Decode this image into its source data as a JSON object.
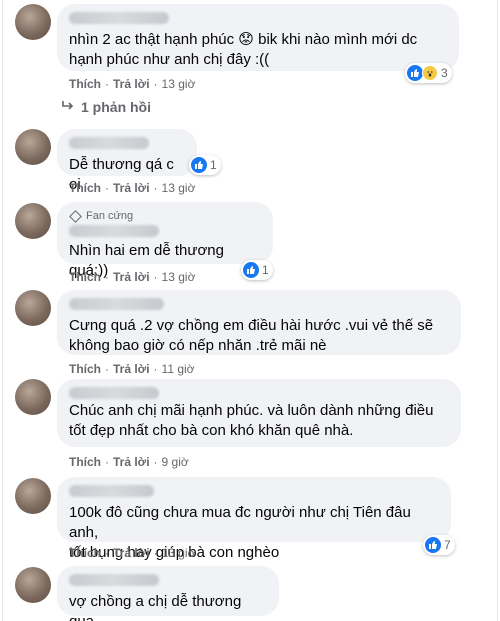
{
  "actions": {
    "like": "Thích",
    "reply": "Trả lời",
    "sep": "·"
  },
  "comments": [
    {
      "text": "nhìn 2 ac thật hạnh phúc 😟 bik khi nào mình mới dc\nhạnh phúc như anh chị đây :((",
      "time": "13 giờ",
      "reactions": "3"
    },
    {
      "text": "Dễ thương qá c oi",
      "time": "13 giờ",
      "reactions": "1"
    },
    {
      "badge": "Fan cứng",
      "text": "Nhìn hai em dễ thương quá:))",
      "time": "13 giờ",
      "reactions": "1"
    },
    {
      "text": "Cưng quá .2 vợ chồng em điều hài hước .vui vẻ thế sẽ\nkhông bao giờ có nếp nhăn .trẻ mãi nè",
      "time": "11 giờ"
    },
    {
      "text": "Chúc anh chị mãi hạnh phúc. và luôn dành những điều\ntốt đẹp nhất cho bà con khó khăn quê nhà.",
      "time": "9 giờ"
    },
    {
      "text": "100k đô cũng chưa mua đc người như chị Tiên đâu anh,\ntốt bụng hay giúp bà con nghèo",
      "time": "13 giờ",
      "reactions": "7"
    },
    {
      "text": "vợ chồng a chị dễ thương qua"
    }
  ],
  "replies_label": "1 phản hồi",
  "colors": {
    "like_blue": "#1877f2",
    "bubble_bg": "#f0f2f5",
    "meta": "#65676b"
  },
  "icons": {
    "like": "like-icon",
    "wow": "wow-icon",
    "reply_arrow": "reply-arrow-icon",
    "fan_badge": "diamond-icon"
  }
}
